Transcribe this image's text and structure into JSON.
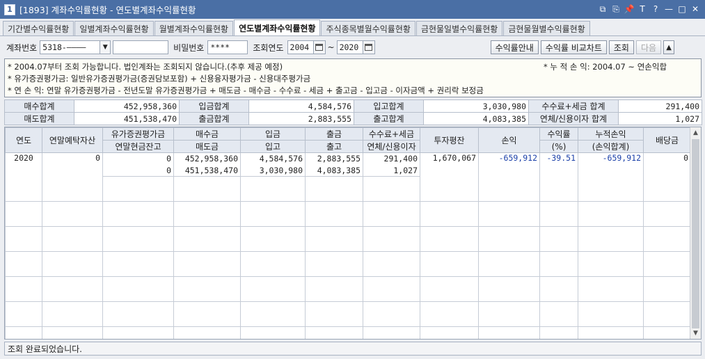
{
  "window": {
    "screen_no": "1",
    "title": "[1893] 계좌수익률현황 - 연도별계좌수익률현황",
    "buttons": [
      "⧉",
      "⎘",
      "📌",
      "T",
      "?",
      "—",
      "□",
      "✕"
    ]
  },
  "tabs": [
    {
      "label": "기간별수익률현황",
      "active": false
    },
    {
      "label": "일별계좌수익률현황",
      "active": false
    },
    {
      "label": "월별계좌수익률현황",
      "active": false
    },
    {
      "label": "연도별계좌수익률현황",
      "active": true
    },
    {
      "label": "주식종목별월수익률현황",
      "active": false
    },
    {
      "label": "금현물일별수익률현황",
      "active": false
    },
    {
      "label": "금현물월별수익률현황",
      "active": false
    }
  ],
  "inputbar": {
    "account_label": "계좌번호",
    "account_value": "5318-‒‒‒‒",
    "account_name": "",
    "password_label": "비밀번호",
    "password_value": "****",
    "year_label": "조회연도",
    "year_from": "2004",
    "tilde": "~",
    "year_to": "2020",
    "guide_button": "수익률안내",
    "chart_button": "수익률 비교차트",
    "search_button": "조회",
    "next_button": "다음",
    "up_button": "▲"
  },
  "notes": {
    "line1": "* 2004.07부터 조회 가능합니다. 법인계좌는 조회되지 않습니다.(추후 제공 예정)",
    "line1_right": "* 누 적 손 익: 2004.07 ~ 연손익합",
    "line2": "* 유가증권평가금: 일반유가증권평가금(증권담보포함) + 신용융자평가금 - 신용대주평가금",
    "line3": "* 연 손 익: 연말 유가증권평가금 - 전년도말 유가증권평가금 + 매도금 - 매수금 - 수수료 - 세금 + 출고금 - 입고금 - 이자금액 + 권리락 보정금"
  },
  "summary": [
    [
      {
        "label": "매수합계",
        "value": "452,958,360"
      },
      {
        "label": "입금합계",
        "value": "4,584,576"
      },
      {
        "label": "입고합계",
        "value": "3,030,980"
      },
      {
        "label": "수수료+세금 합계",
        "value": "291,400"
      }
    ],
    [
      {
        "label": "매도합계",
        "value": "451,538,470"
      },
      {
        "label": "출금합계",
        "value": "2,883,555"
      },
      {
        "label": "출고합계",
        "value": "4,083,385"
      },
      {
        "label": "연체/신용이자 합계",
        "value": "1,027"
      }
    ]
  ],
  "grid": {
    "headers": {
      "year": "연도",
      "yearend_deposit": "연말예탁자산",
      "sec_eval": "유가증권평가금",
      "yearend_cash": "연말현금잔고",
      "buy": "매수금",
      "sell": "매도금",
      "deposit": "입금",
      "stock_in": "입고",
      "withdraw": "출금",
      "stock_out": "출고",
      "fee_tax": "수수료+세금",
      "interest": "연체/신용이자",
      "invest_avg": "투자평잔",
      "pnl": "손익",
      "rate": "수익률",
      "rate_unit": "(%)",
      "cum_pnl": "누적손익",
      "cum_pnl_sub": "(손익합계)",
      "dividend": "배당금"
    },
    "rows": [
      {
        "year": "2020",
        "yearend_deposit": "0",
        "sec_eval": "0",
        "yearend_cash": "0",
        "buy": "452,958,360",
        "sell": "451,538,470",
        "deposit": "4,584,576",
        "stock_in": "3,030,980",
        "withdraw": "2,883,555",
        "stock_out": "4,083,385",
        "fee_tax": "291,400",
        "interest": "1,027",
        "invest_avg": "1,670,067",
        "pnl": "-659,912",
        "rate": "-39.51",
        "cum_pnl": "-659,912",
        "dividend": "0"
      }
    ]
  },
  "status": {
    "text": "조회 완료되었습니다."
  },
  "colors": {
    "titlebar": "#4a6fa5",
    "header_bg": "#e4e9f1",
    "negative": "#1a3fa8"
  }
}
